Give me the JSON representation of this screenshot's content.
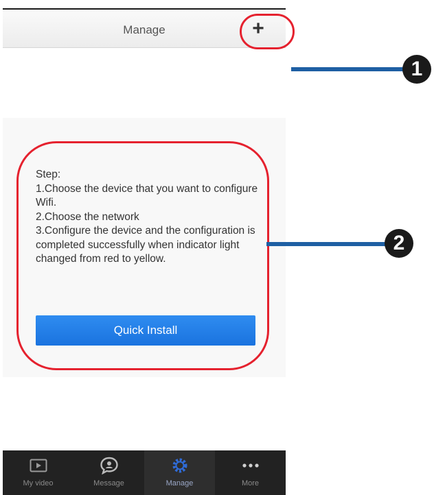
{
  "header": {
    "title": "Manage",
    "add_label": "+"
  },
  "steps": {
    "heading": "Step:",
    "lines": [
      "1.Choose the device that you want to configure Wifi.",
      "2.Choose the network",
      "3.Configure the device and the configuration is completed successfully when indicator light changed from red to yellow."
    ]
  },
  "install_button": {
    "label": "Quick Install"
  },
  "nav": {
    "items": [
      {
        "label": "My video",
        "icon": "video-icon"
      },
      {
        "label": "Message",
        "icon": "message-icon"
      },
      {
        "label": "Manage",
        "icon": "gear-icon"
      },
      {
        "label": "More",
        "icon": "more-icon"
      }
    ],
    "active": "Manage"
  },
  "annotations": {
    "callout_1": "1",
    "callout_2": "2"
  },
  "colors": {
    "accent": "#1a73df",
    "highlight": "#e5212e",
    "annotation_line": "#1e5fa3"
  }
}
